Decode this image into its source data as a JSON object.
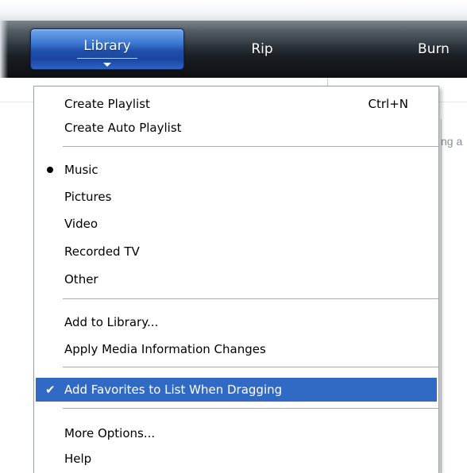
{
  "toolbar": {
    "tabs": [
      {
        "label": "Library"
      },
      {
        "label": "Rip"
      },
      {
        "label": "Burn"
      }
    ]
  },
  "background": {
    "partial_text": "ng a"
  },
  "menu": {
    "items": {
      "create_playlist": {
        "label": "Create Playlist",
        "shortcut": "Ctrl+N"
      },
      "create_auto_playlist": {
        "label": "Create Auto Playlist"
      },
      "music": {
        "label": "Music",
        "selected": true
      },
      "pictures": {
        "label": "Pictures"
      },
      "video": {
        "label": "Video"
      },
      "recorded_tv": {
        "label": "Recorded TV"
      },
      "other": {
        "label": "Other"
      },
      "add_to_library": {
        "label": "Add to Library..."
      },
      "apply_media_info": {
        "label": "Apply Media Information Changes"
      },
      "add_favorites": {
        "label": "Add Favorites to List When Dragging",
        "checked": true,
        "highlighted": true
      },
      "more_options": {
        "label": "More Options..."
      },
      "help": {
        "label": "Help"
      }
    }
  },
  "colors": {
    "highlight": "#316ac5",
    "library_tab": "#2d63c4",
    "toolbar": "#1a1f24"
  }
}
